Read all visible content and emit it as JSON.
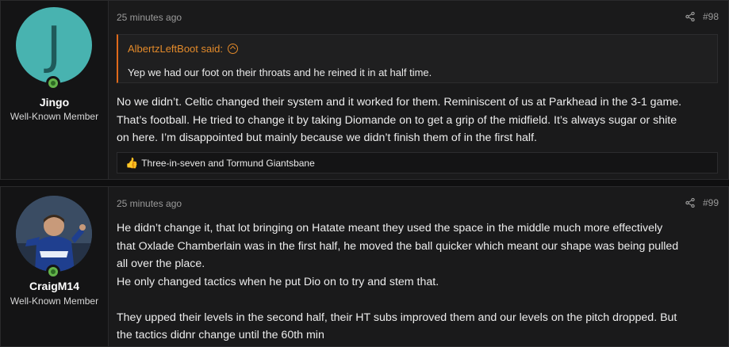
{
  "posts": [
    {
      "user": {
        "avatar_letter": "J",
        "name": "Jingo",
        "title": "Well-Known Member"
      },
      "time": "25 minutes ago",
      "number": "#98",
      "quote": {
        "author": "AlbertzLeftBoot said:",
        "text": "Yep we had our foot on their throats and he reined it in at half time."
      },
      "lines": [
        "No we didn’t. Celtic changed their system and it worked for them. Reminiscent of us at Parkhead in the 3-1 game.",
        "That’s football. He tried to change it by taking Diomande on to get a grip of the midfield. It’s always sugar or shite",
        "on here. I’m disappointed but mainly because we didn’t finish them of in the first half."
      ],
      "reactions": "Three-in-seven and Tormund Giantsbane"
    },
    {
      "user": {
        "name": "CraigM14",
        "title": "Well-Known Member"
      },
      "time": "25 minutes ago",
      "number": "#99",
      "lines": [
        "He didn’t change it, that lot bringing on Hatate meant they used the space in the middle much more effectively",
        "that Oxlade Chamberlain was in the first half, he moved the ball quicker which meant our shape was being pulled",
        "all over the place.",
        "He only changed tactics when he put Dio on to try and stem that.",
        "",
        "They upped their levels in the second half, their HT subs improved them and our levels on the pitch dropped. But",
        "the tactics didnr change until the 60th min"
      ]
    }
  ]
}
